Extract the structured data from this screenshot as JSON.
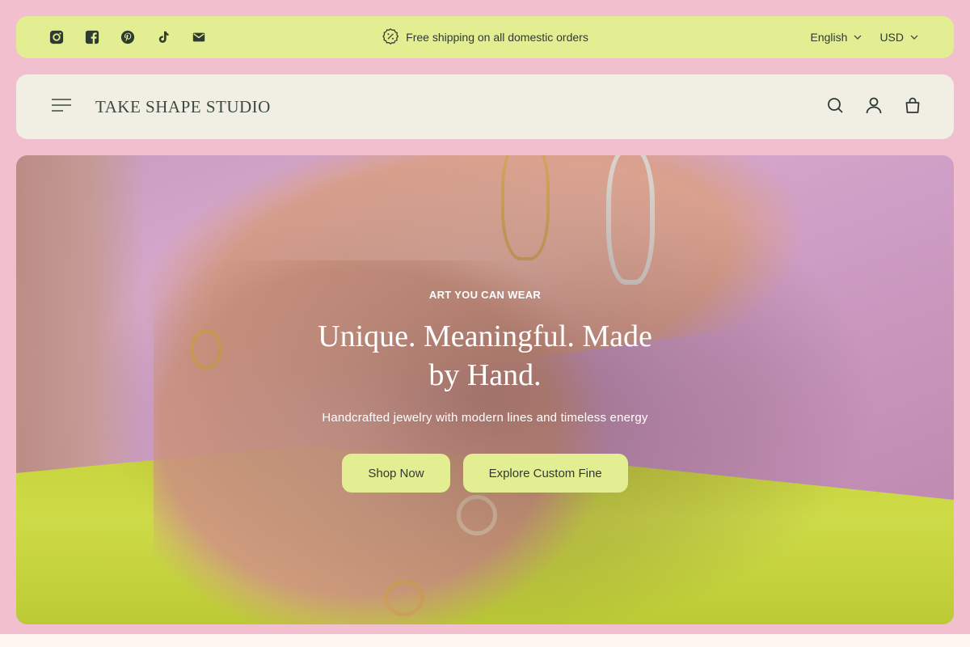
{
  "announcement": {
    "socials": [
      {
        "icon": "instagram-icon"
      },
      {
        "icon": "facebook-icon"
      },
      {
        "icon": "pinterest-icon"
      },
      {
        "icon": "tiktok-icon"
      },
      {
        "icon": "email-icon"
      }
    ],
    "promo_icon": "discount-badge-icon",
    "promo_text": "Free shipping on all domestic orders",
    "language": "English",
    "currency": "USD"
  },
  "header": {
    "brand": "TAKE SHAPE STUDIO",
    "icons": [
      "menu-icon",
      "search-icon",
      "account-icon",
      "cart-icon"
    ]
  },
  "hero": {
    "eyebrow": "ART YOU CAN WEAR",
    "headline": "Unique. Meaningful. Made by Hand.",
    "subline": "Handcrafted jewelry with modern lines and timeless energy",
    "primary_cta": "Shop Now",
    "secondary_cta": "Explore Custom Fine"
  },
  "colors": {
    "page_bg": "#f2bfcf",
    "announcement_bg": "#e3ee92",
    "header_bg": "#f1efe4",
    "button_bg": "#e3ee92",
    "text_dark": "#2f3a33"
  }
}
